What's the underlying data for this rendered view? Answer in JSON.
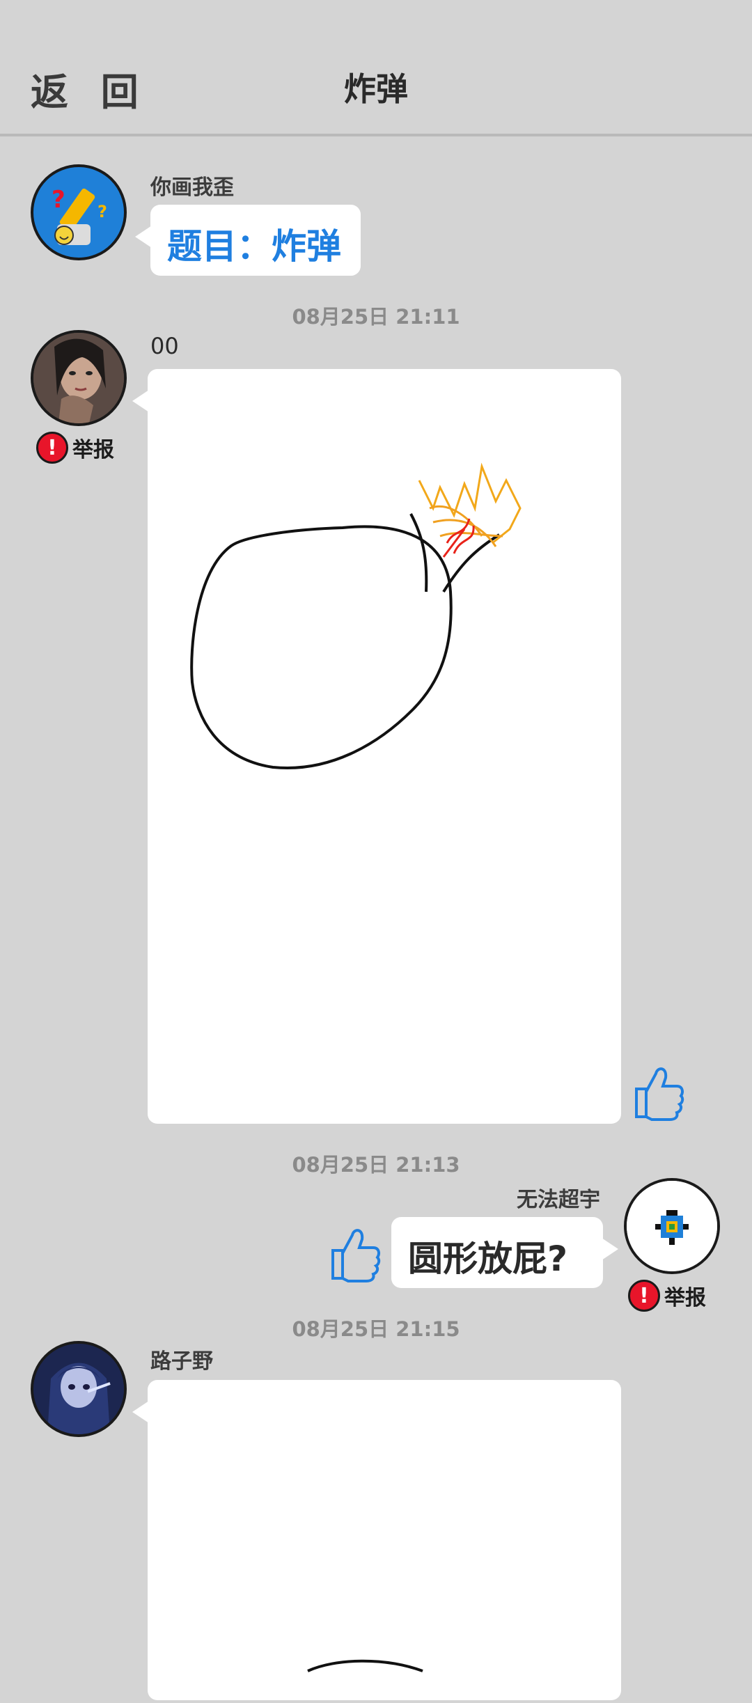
{
  "header": {
    "back_label": "返 回",
    "title": "炸弹"
  },
  "messages": {
    "host": {
      "name": "你画我歪",
      "text": "题目：炸弹"
    },
    "time1": "08月25日  21:11",
    "m1": {
      "name": "00",
      "report": "举报"
    },
    "time2": "08月25日  21:13",
    "m2": {
      "name": "无法超宇",
      "text": "圆形放屁?",
      "report": "举报"
    },
    "time3": "08月25日  21:15",
    "m3": {
      "name": "路子野"
    }
  },
  "colors": {
    "accent_blue": "#1f7fe0",
    "report_red": "#e8152a",
    "background": "#d4d4d4"
  },
  "icons": {
    "avatar_host": "pencil-question-icon",
    "avatar_m1": "user-photo",
    "avatar_m2": "pixel-sprite-icon",
    "avatar_m3": "anime-girl-avatar",
    "like": "thumbs-up-icon",
    "report": "exclamation-icon"
  }
}
